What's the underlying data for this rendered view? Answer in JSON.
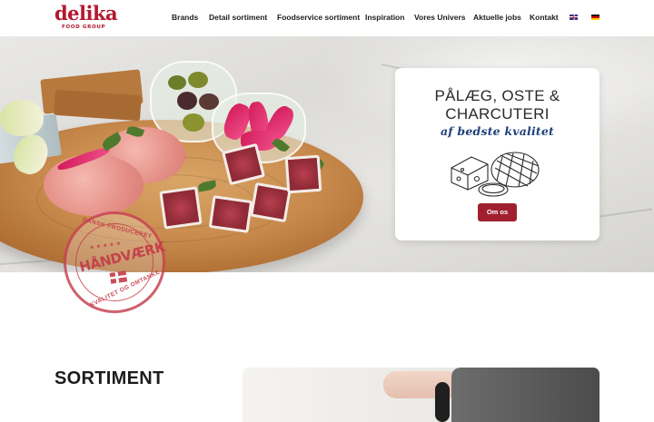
{
  "brand": {
    "name": "delika",
    "sub": "FOOD GROUP",
    "color": "#b4172f"
  },
  "nav": {
    "items": [
      {
        "label": "Brands"
      },
      {
        "label": "Detail sortiment"
      },
      {
        "label": "Foodservice sortiment"
      },
      {
        "label": "Inspiration"
      },
      {
        "label": "Vores Univers"
      },
      {
        "label": "Aktuelle jobs"
      },
      {
        "label": "Kontakt"
      }
    ],
    "languages": [
      {
        "icon": "uk-flag-icon"
      },
      {
        "icon": "german-flag-icon"
      }
    ]
  },
  "hero": {
    "stamp": {
      "top": "DANSK PRODUCERET",
      "main": "HÅNDVÆRK",
      "bottom": "KVALITET OG OMTANKE"
    },
    "card": {
      "title_line1": "PÅLÆG, OSTE &",
      "title_line2": "CHARCUTERI",
      "script": "af bedste kvalitet",
      "button": "Om os",
      "accent": "#a0202f",
      "script_color": "#1e3f7a"
    }
  },
  "section": {
    "title": "SORTIMENT"
  }
}
